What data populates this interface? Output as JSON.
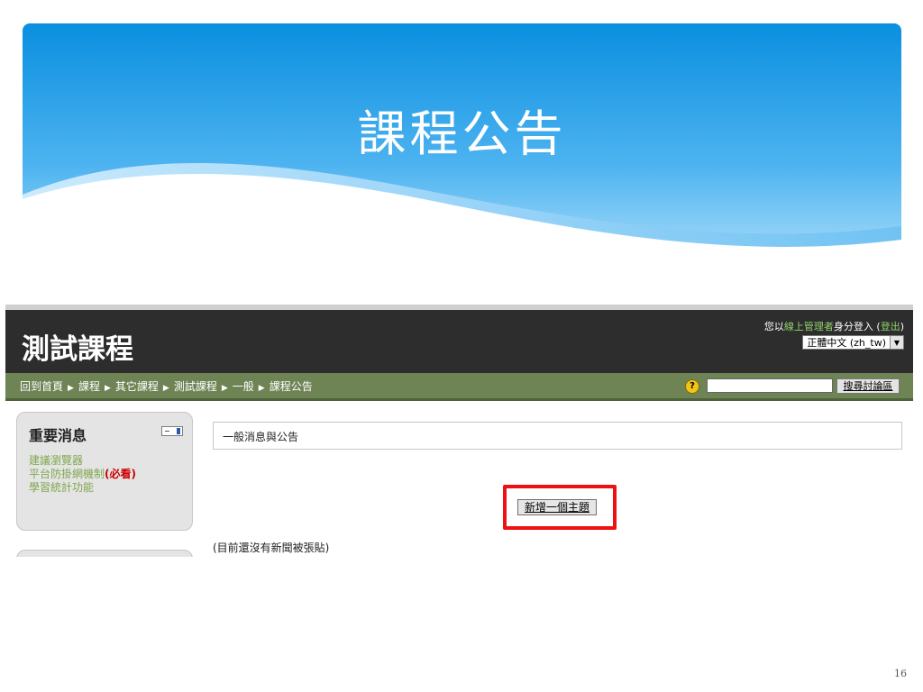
{
  "slide": {
    "title": "課程公告",
    "page_number": "16"
  },
  "course": {
    "title": "測試課程",
    "login": {
      "prefix": "您以",
      "role_link": "線上管理者",
      "suffix": "身分登入 (",
      "logout_link": "登出",
      "close": ")"
    },
    "language": "正體中文 (zh_tw)",
    "breadcrumbs": [
      "回到首頁",
      "課程",
      "其它課程",
      "測試課程",
      "一般",
      "課程公告"
    ],
    "breadcrumb_separator": "▶",
    "search_button": "搜尋討論區",
    "news_block": {
      "title": "重要消息",
      "links": [
        "建議瀏覽器",
        "平台防掛網機制",
        "學習統計功能"
      ],
      "must_read": "(必看)"
    },
    "forum": {
      "description": "一般消息與公告",
      "add_topic_button": "新增一個主題",
      "empty_message": "(目前還沒有新聞被張貼)"
    }
  }
}
